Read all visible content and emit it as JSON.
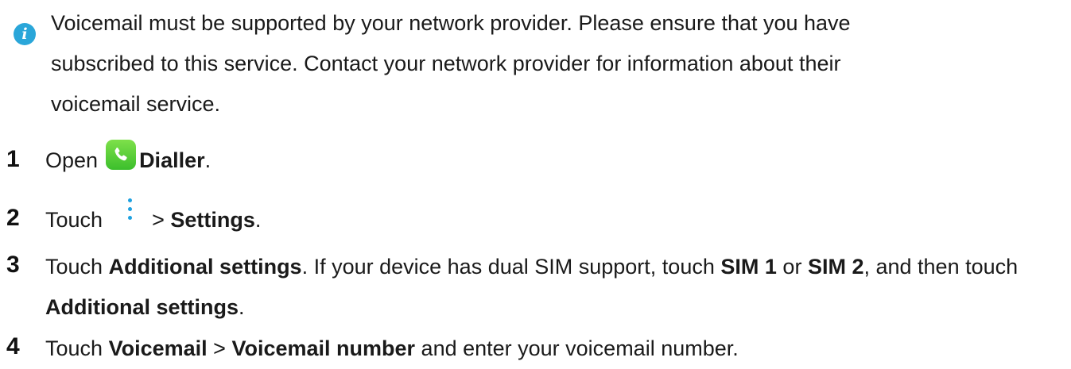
{
  "note": {
    "icon": "info-icon",
    "text": "Voicemail must be supported by your network provider. Please ensure that you have subscribed to this service. Contact your network provider for information about their voicemail service."
  },
  "steps": [
    {
      "number": "1",
      "prefix": "Open",
      "icon": "dialler-app-icon",
      "bold": "Dialler",
      "suffix": "."
    },
    {
      "number": "2",
      "prefix": "Touch",
      "icon": "more-options-icon",
      "separator": ">",
      "bold": "Settings",
      "suffix": "."
    },
    {
      "number": "3",
      "prefix": "Touch",
      "bold1": "Additional settings",
      "text1": ". If your device has dual SIM support, touch",
      "bold2": "SIM 1",
      "text2": "or",
      "bold3": "SIM 2",
      "text3": ", and then touch",
      "bold4": "Additional settings",
      "suffix": "."
    },
    {
      "number": "4",
      "prefix": "Touch",
      "bold1": "Voicemail",
      "separator": ">",
      "bold2": "Voicemail number",
      "suffix": "and enter your voicemail number."
    }
  ],
  "colors": {
    "info_icon": "#2aa6d9",
    "dialler_icon": "#4cc736",
    "more_icon": "#1ea1e0"
  }
}
